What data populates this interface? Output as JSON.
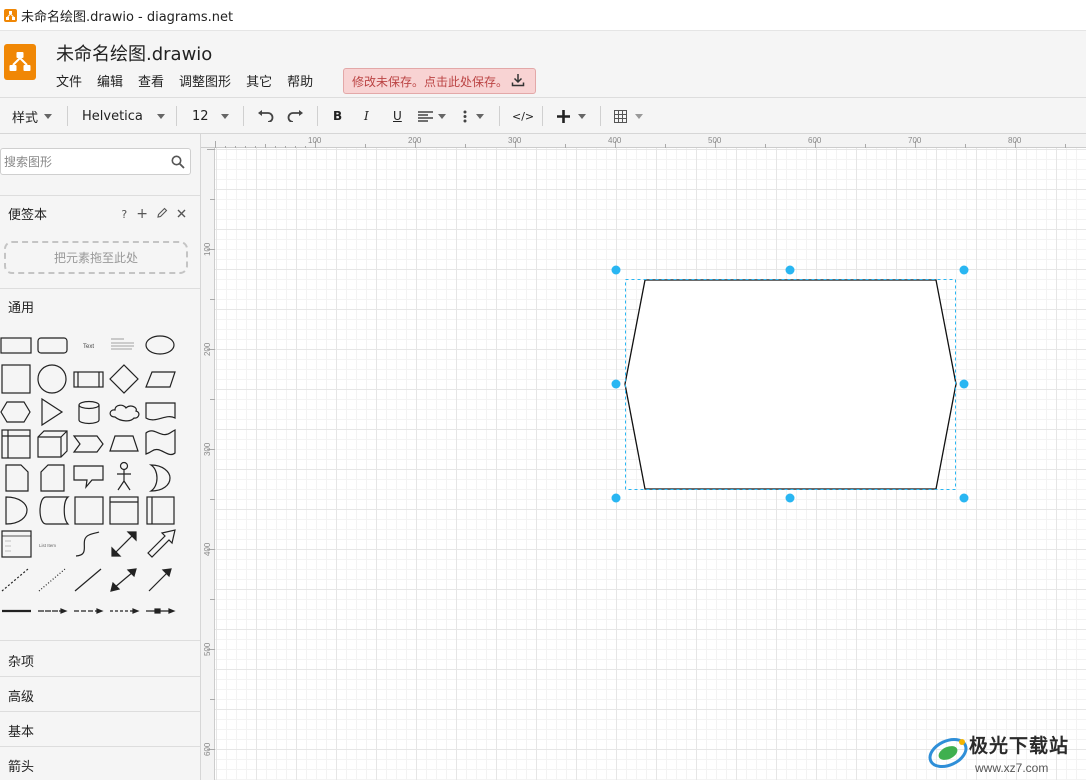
{
  "window": {
    "title": "未命名绘图.drawio - diagrams.net"
  },
  "header": {
    "doc_title": "未命名绘图.drawio",
    "menu": [
      "文件",
      "编辑",
      "查看",
      "调整图形",
      "其它",
      "帮助"
    ],
    "save_alert": "修改未保存。点击此处保存。"
  },
  "toolbar": {
    "style_label": "样式",
    "font_family": "Helvetica",
    "font_size": "12",
    "bold": "B",
    "italic": "I",
    "underline": "U",
    "html_label": "</>"
  },
  "sidebar": {
    "search_placeholder": "搜索图形",
    "scratchpad": {
      "title": "便签本",
      "help": "?",
      "add": "+",
      "drop_hint": "把元素拖至此处"
    },
    "general_title": "通用",
    "categories": [
      "杂项",
      "高级",
      "基本",
      "箭头"
    ]
  },
  "ruler": {
    "top_ticks": [
      "100",
      "200",
      "300",
      "400",
      "500",
      "600",
      "700",
      "800"
    ],
    "left_ticks": [
      "100",
      "200",
      "300",
      "400",
      "500",
      "600"
    ]
  },
  "watermark": {
    "name": "极光下载站",
    "url": "www.xz7.com"
  },
  "colors": {
    "accent": "#f08705",
    "selection": "#29b6f2",
    "alert_bg": "#f8d3d3",
    "alert_text": "#bb4444"
  }
}
